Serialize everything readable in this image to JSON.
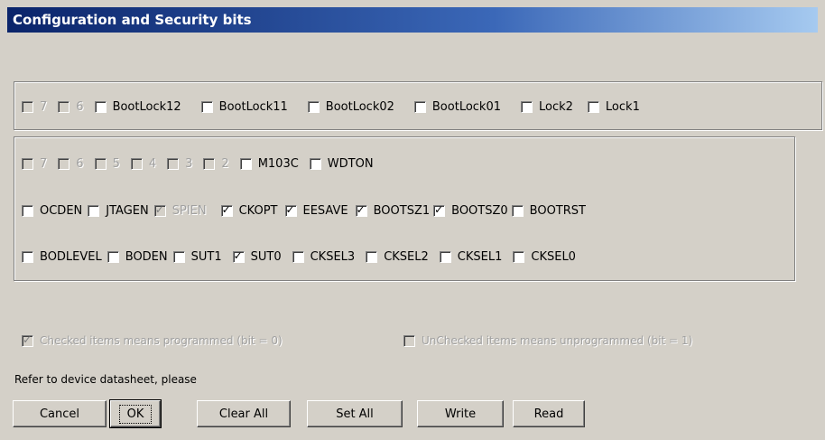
{
  "window": {
    "title": "Configuration and Security bits"
  },
  "lock_bits": [
    {
      "label": "7",
      "checked": false,
      "disabled": true
    },
    {
      "label": "6",
      "checked": false,
      "disabled": true
    },
    {
      "label": "BootLock12",
      "checked": false,
      "disabled": false
    },
    {
      "label": "BootLock11",
      "checked": false,
      "disabled": false
    },
    {
      "label": "BootLock02",
      "checked": false,
      "disabled": false
    },
    {
      "label": "BootLock01",
      "checked": false,
      "disabled": false
    },
    {
      "label": "Lock2",
      "checked": false,
      "disabled": false
    },
    {
      "label": "Lock1",
      "checked": false,
      "disabled": false
    }
  ],
  "fuse_rows": [
    [
      {
        "label": "7",
        "checked": false,
        "disabled": true
      },
      {
        "label": "6",
        "checked": false,
        "disabled": true
      },
      {
        "label": "5",
        "checked": false,
        "disabled": true
      },
      {
        "label": "4",
        "checked": false,
        "disabled": true
      },
      {
        "label": "3",
        "checked": false,
        "disabled": true
      },
      {
        "label": "2",
        "checked": false,
        "disabled": true
      },
      {
        "label": "M103C",
        "checked": false,
        "disabled": false
      },
      {
        "label": "WDTON",
        "checked": false,
        "disabled": false
      }
    ],
    [
      {
        "label": "OCDEN",
        "checked": false,
        "disabled": false
      },
      {
        "label": "JTAGEN",
        "checked": false,
        "disabled": false
      },
      {
        "label": "SPIEN",
        "checked": true,
        "disabled": true
      },
      {
        "label": "CKOPT",
        "checked": true,
        "disabled": false
      },
      {
        "label": "EESAVE",
        "checked": true,
        "disabled": false
      },
      {
        "label": "BOOTSZ1",
        "checked": true,
        "disabled": false
      },
      {
        "label": "BOOTSZ0",
        "checked": true,
        "disabled": false
      },
      {
        "label": "BOOTRST",
        "checked": false,
        "disabled": false
      }
    ],
    [
      {
        "label": "BODLEVEL",
        "checked": false,
        "disabled": false
      },
      {
        "label": "BODEN",
        "checked": false,
        "disabled": false
      },
      {
        "label": "SUT1",
        "checked": false,
        "disabled": false
      },
      {
        "label": "SUT0",
        "checked": true,
        "disabled": false
      },
      {
        "label": "CKSEL3",
        "checked": false,
        "disabled": false
      },
      {
        "label": "CKSEL2",
        "checked": false,
        "disabled": false
      },
      {
        "label": "CKSEL1",
        "checked": false,
        "disabled": false
      },
      {
        "label": "CKSEL0",
        "checked": false,
        "disabled": false
      }
    ]
  ],
  "legend": {
    "checked": {
      "label": "Checked items means programmed (bit = 0)",
      "checked": true
    },
    "unchecked": {
      "label": "UnChecked items means unprogrammed (bit = 1)",
      "checked": false
    }
  },
  "note": "Refer to device datasheet, please",
  "buttons": {
    "cancel": "Cancel",
    "ok": "OK",
    "clear_all": "Clear All",
    "set_all": "Set All",
    "write": "Write",
    "read": "Read"
  }
}
